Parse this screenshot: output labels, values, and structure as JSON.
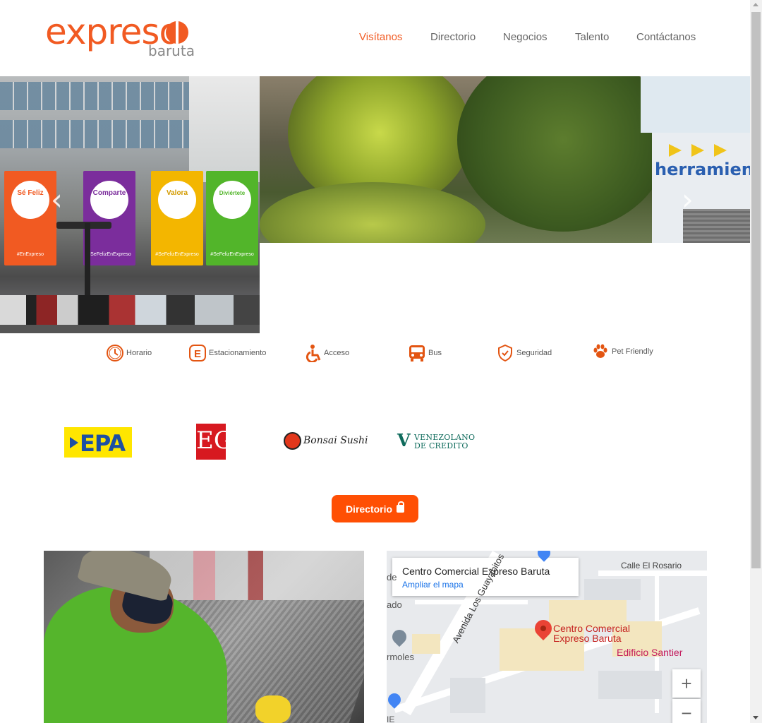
{
  "brand": {
    "name": "expreso",
    "sub": "baruta"
  },
  "nav": [
    {
      "label": "Visítanos",
      "active": true
    },
    {
      "label": "Directorio"
    },
    {
      "label": "Negocios"
    },
    {
      "label": "Talento"
    },
    {
      "label": "Contáctanos"
    }
  ],
  "hero": {
    "banners": [
      {
        "text": "Sé Feliz",
        "foot": "#EnExpreso"
      },
      {
        "text": "Comparte",
        "foot": "#SeFelizEnExpreso"
      },
      {
        "text": "Valora",
        "foot": "#SeFelizEnExpreso"
      },
      {
        "text": "Diviértete",
        "foot": "#SeFelizEnExpreso"
      }
    ],
    "sign_text": "herramienta",
    "prev_icon": "chevron-left-icon",
    "next_icon": "chevron-right-icon"
  },
  "amenities": [
    {
      "label": "Horario",
      "icon": "clock-icon"
    },
    {
      "label": "Estacionamiento",
      "icon": "parking-icon"
    },
    {
      "label": "Acceso",
      "icon": "wheelchair-icon"
    },
    {
      "label": "Bus",
      "icon": "bus-icon"
    },
    {
      "label": "Seguridad",
      "icon": "shield-icon"
    },
    {
      "label": "Pet Friendly",
      "icon": "paw-icon"
    }
  ],
  "brands": {
    "epa": "EPA",
    "eg": "EG",
    "bonsai": "Bonsai Sushi",
    "venezolano": [
      "VENEZOLANO",
      "DE CREDITO"
    ]
  },
  "directory_button": {
    "label": "Directorio",
    "icon": "shopping-bag-icon"
  },
  "map": {
    "card_title": "Centro Comercial Expreso Baruta",
    "card_link": "Ampliar el mapa",
    "pin_label": "Centro Comercial\nExpreso Baruta",
    "labels": {
      "street1": "Calle El Rosario",
      "street2": "Avenida Los Guayabitos",
      "poi": "Edificio Santier",
      "left1": "de",
      "left2": "ado",
      "left3": "rmoles",
      "left4": "IE"
    },
    "zoom_in": "+",
    "zoom_out": "−"
  },
  "colors": {
    "accent": "#f15a22",
    "button": "#ff4f04",
    "link": "#1a73e8"
  }
}
